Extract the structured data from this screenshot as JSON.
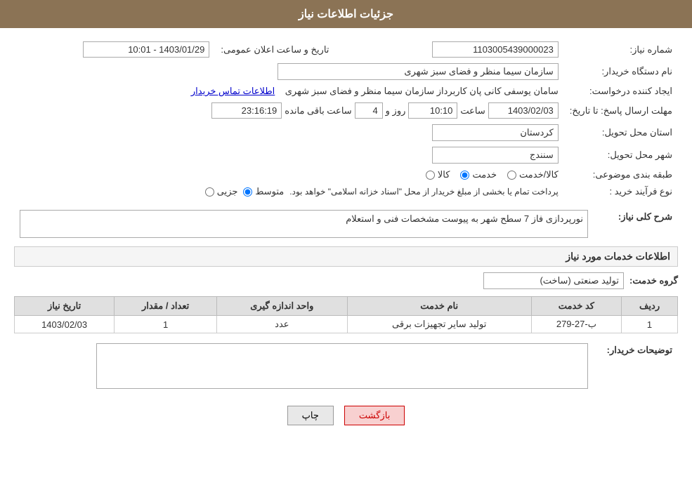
{
  "header": {
    "title": "جزئیات اطلاعات نیاز"
  },
  "fields": {
    "need_number_label": "شماره نیاز:",
    "need_number_value": "1103005439000023",
    "buyer_org_label": "نام دستگاه خریدار:",
    "buyer_org_value": "سازمان سیما  منظر و فضای سبز شهری",
    "requester_label": "ایجاد کننده درخواست:",
    "requester_value": "سامان یوسفی کانی پان کاربرداز سازمان سیما  منظر و فضای سبز شهری",
    "requester_link": "اطلاعات تماس خریدار",
    "announce_date_label": "تاریخ و ساعت اعلان عمومی:",
    "announce_date_value": "1403/01/29 - 10:01",
    "reply_deadline_label": "مهلت ارسال پاسخ: تا تاریخ:",
    "reply_date": "1403/02/03",
    "reply_time_label": "ساعت",
    "reply_time": "10:10",
    "reply_days_label": "روز و",
    "reply_days": "4",
    "reply_remaining_label": "ساعت باقی مانده",
    "reply_remaining": "23:16:19",
    "province_label": "استان محل تحویل:",
    "province_value": "کردستان",
    "city_label": "شهر محل تحویل:",
    "city_value": "سنندج",
    "category_label": "طبقه بندی موضوعی:",
    "category_options": [
      {
        "label": "کالا",
        "value": "kala"
      },
      {
        "label": "خدمت",
        "value": "khedmat"
      },
      {
        "label": "کالا/خدمت",
        "value": "kala_khedmat"
      }
    ],
    "category_selected": "khedmat",
    "process_label": "نوع فرآیند خرید :",
    "process_options": [
      {
        "label": "جزیی",
        "value": "jozi"
      },
      {
        "label": "متوسط",
        "value": "motavaset"
      }
    ],
    "process_selected": "motavaset",
    "process_notice": "پرداخت تمام یا بخشی از مبلغ خریدار از محل \"اسناد خزانه اسلامی\" خواهد بود.",
    "need_summary_label": "شرح کلی نیاز:",
    "need_summary_value": "نورپردازی فاز 7 سطح شهر به پیوست مشخصات فنی و استعلام"
  },
  "services_section": {
    "title": "اطلاعات خدمات مورد نیاز",
    "group_label": "گروه خدمت:",
    "group_value": "تولید صنعتی (ساخت)",
    "table_headers": [
      "ردیف",
      "کد خدمت",
      "نام خدمت",
      "واحد اندازه گیری",
      "تعداد / مقدار",
      "تاریخ نیاز"
    ],
    "table_rows": [
      {
        "row": "1",
        "code": "ب-27-279",
        "name": "تولید سایر تجهیزات برقی",
        "unit": "عدد",
        "quantity": "1",
        "date": "1403/02/03"
      }
    ]
  },
  "buyer_description": {
    "label": "توضیحات خریدار:",
    "value": ""
  },
  "buttons": {
    "print_label": "چاپ",
    "back_label": "بازگشت"
  }
}
